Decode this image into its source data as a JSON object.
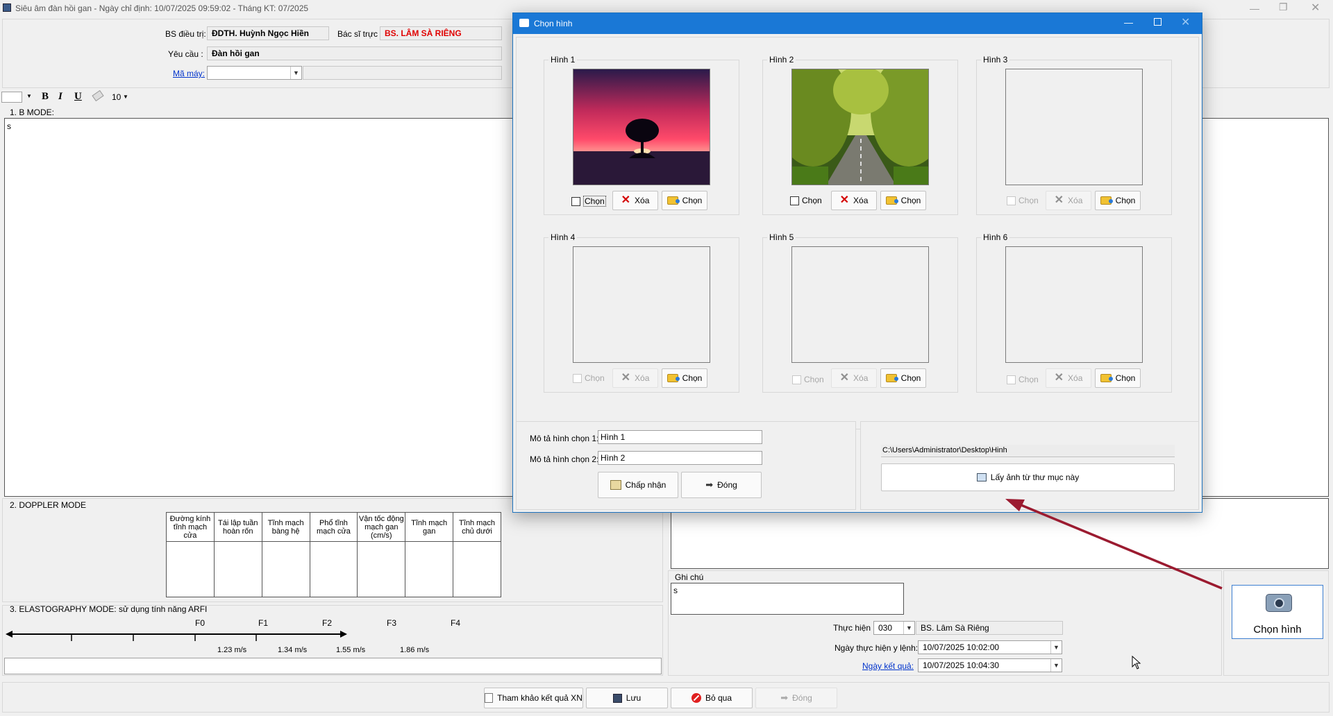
{
  "window": {
    "title": "Siêu âm đàn hồi gan - Ngày chỉ định: 10/07/2025 09:59:02 - Tháng KT: 07/2025"
  },
  "header": {
    "bs_dieu_tri_label": "BS điều trị:",
    "bs_dieu_tri_value": "ĐDTH. Huỳnh Ngọc Hiền",
    "bac_si_truc_label": "Bác sĩ trực :",
    "bac_si_truc_value": "BS. LÂM SÀ RIÊNG",
    "yeu_cau_label": "Yêu cầu :",
    "yeu_cau_value": "Đàn hồi gan",
    "ma_may_label": "Mã máy:",
    "ma_may_value": ""
  },
  "toolbar": {
    "bold": "B",
    "italic": "I",
    "underline": "U",
    "font_size": "10"
  },
  "bmode": {
    "title": "1. B MODE:",
    "text": "s"
  },
  "doppler": {
    "title": "2. DOPPLER MODE",
    "columns": [
      "Đường kính tĩnh mạch cửa",
      "Tái lập tuần hoàn rốn",
      "Tĩnh mạch bàng hệ",
      "Phổ tĩnh mạch cửa",
      "Vận tốc động mạch gan (cm/s)",
      "Tĩnh mạch gan",
      "Tĩnh mạch chủ dưới"
    ]
  },
  "elastography": {
    "title": "3. ELASTOGRAPHY MODE: sử dụng tính năng ARFI",
    "levels": [
      "F0",
      "F1",
      "F2",
      "F3",
      "F4"
    ],
    "speeds": [
      "1.23 m/s",
      "1.34 m/s",
      "1.55 m/s",
      "1.86 m/s"
    ],
    "input_value": ""
  },
  "right_panel": {
    "ghi_chu_label": "Ghi chú",
    "ghi_chu_value": "s",
    "thuc_hien_label": "Thực hiện :",
    "thuc_hien_code": "030",
    "thuc_hien_name": "BS. Lâm Sà Riêng",
    "ngay_thuc_hien_label": "Ngày thực hiện y lệnh:",
    "ngay_thuc_hien_value": "10/07/2025 10:02:00",
    "ngay_ket_qua_label": "Ngày kết quả:",
    "ngay_ket_qua_value": "10/07/2025 10:04:30",
    "chon_hinh_label": "Chọn hình"
  },
  "bottom_buttons": {
    "tham_khao": "Tham khảo kết quả XN",
    "luu": "Lưu",
    "bo_qua": "Bỏ qua",
    "dong": "Đóng"
  },
  "dialog": {
    "title": "Chọn hình",
    "images": [
      {
        "label": "Hình 1",
        "checkbox_label": "Chọn",
        "delete_label": "Xóa",
        "choose_label": "Chọn"
      },
      {
        "label": "Hình 2",
        "checkbox_label": "Chọn",
        "delete_label": "Xóa",
        "choose_label": "Chọn"
      },
      {
        "label": "Hình 3",
        "checkbox_label": "Chọn",
        "delete_label": "Xóa",
        "choose_label": "Chọn"
      },
      {
        "label": "Hình 4",
        "checkbox_label": "Chọn",
        "delete_label": "Xóa",
        "choose_label": "Chọn"
      },
      {
        "label": "Hình 5",
        "checkbox_label": "Chọn",
        "delete_label": "Xóa",
        "choose_label": "Chọn"
      },
      {
        "label": "Hình 6",
        "checkbox_label": "Chọn",
        "delete_label": "Xóa",
        "choose_label": "Chọn"
      }
    ],
    "mo_ta_1_label": "Mô tả hình chọn 1:",
    "mo_ta_1_value": "Hình 1",
    "mo_ta_2_label": "Mô tả hình chọn 2:",
    "mo_ta_2_value": "Hình 2",
    "chap_nhan": "Chấp nhận",
    "dong": "Đóng",
    "folder_path": "C:\\Users\\Administrator\\Desktop\\Hinh",
    "lay_anh": "Lấy ảnh từ thư mục này"
  },
  "colors": {
    "dialog_titlebar": "#1a78d6",
    "arrow": "#9b1b30",
    "bac_si_truc_text": "#e00000",
    "link": "#0033cc"
  }
}
